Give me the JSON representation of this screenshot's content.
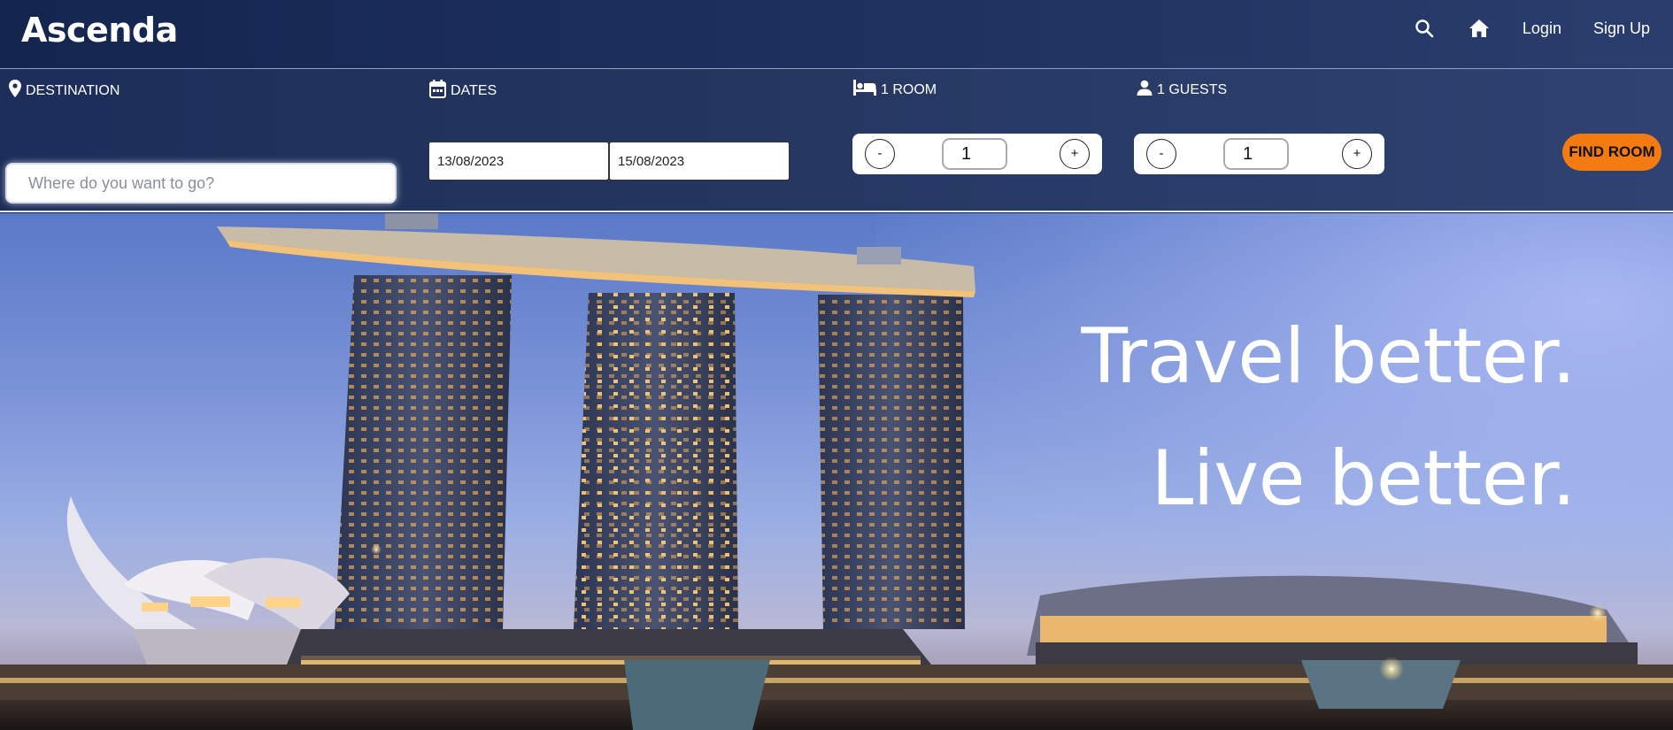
{
  "header": {
    "logo": "Ascenda",
    "nav": {
      "search_icon": "search-icon",
      "home_icon": "home-icon",
      "login": "Login",
      "signup": "Sign Up"
    }
  },
  "search": {
    "destination": {
      "label": "DESTINATION",
      "icon": "map-pin-icon",
      "placeholder": "Where do you want to go?",
      "value": ""
    },
    "dates": {
      "label": "DATES",
      "icon": "calendar-icon",
      "start": "13/08/2023",
      "end": "15/08/2023"
    },
    "rooms": {
      "label": "1 ROOM",
      "icon": "bed-icon",
      "minus": "-",
      "plus": "+",
      "value": "1"
    },
    "guests": {
      "label": "1 GUESTS",
      "icon": "person-icon",
      "minus": "-",
      "plus": "+",
      "value": "1"
    },
    "submit": "FIND ROOM"
  },
  "hero": {
    "tagline_line1": "Travel better.",
    "tagline_line2": "Live better."
  },
  "colors": {
    "nav_bg": "#14264f",
    "accent": "#f47a12",
    "text": "#ffffff"
  }
}
